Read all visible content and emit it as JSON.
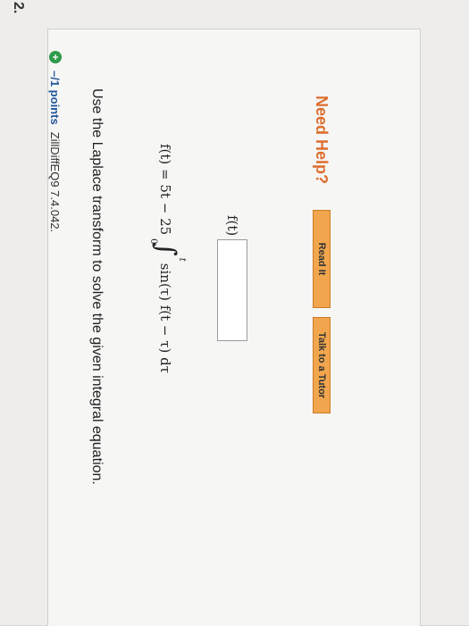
{
  "question": {
    "number": "2.",
    "points": "–/1 points",
    "id": "ZillDiffEQ9 7.4.042.",
    "instruction": "Use the Laplace transform to solve the given integral equation."
  },
  "equation": {
    "lhs": "f(t) = 5t − 25",
    "integral_symbol": "∫",
    "upper_limit": "t",
    "lower_limit": "0",
    "integrand": "sin(τ) f(t − τ) dτ"
  },
  "answer": {
    "label": "f(t) =",
    "value": ""
  },
  "help": {
    "label": "Need Help?",
    "read_it": "Read It",
    "talk_to_tutor": "Talk to a Tutor"
  },
  "colors": {
    "accent_orange": "#e69a62",
    "help_text": "#dd6e2d",
    "button_bg": "#f1a64e",
    "points_blue": "#24579c",
    "plus_green": "#2f9b49"
  }
}
